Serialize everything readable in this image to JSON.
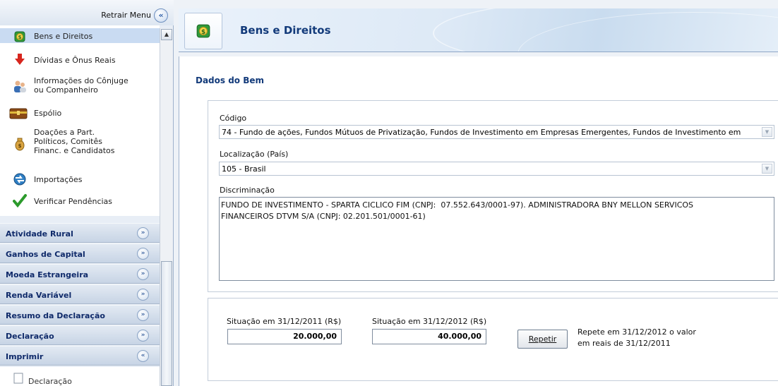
{
  "sidebar": {
    "collapse_label": "Retrair Menu",
    "items": [
      {
        "label": "Bens e Direitos",
        "icon": "money-bag-icon",
        "selected": true
      },
      {
        "label": "Dívidas e Ônus Reais",
        "icon": "red-down-arrow-icon"
      },
      {
        "label": "Informações do Cônjuge\nou Companheiro",
        "icon": "couple-icon"
      },
      {
        "label": "Espólio",
        "icon": "chest-icon"
      },
      {
        "label": "Doações a Part.\nPolíticos, Comitês\nFinanc. e Candidatos",
        "icon": "donation-bag-icon"
      },
      {
        "label": "Importações",
        "icon": "globe-icon"
      },
      {
        "label": "Verificar Pendências",
        "icon": "checkmark-icon"
      }
    ],
    "sections": [
      {
        "label": "Atividade Rural",
        "state": "collapsed"
      },
      {
        "label": "Ganhos de Capital",
        "state": "collapsed"
      },
      {
        "label": "Moeda Estrangeira",
        "state": "collapsed"
      },
      {
        "label": "Renda Variável",
        "state": "collapsed"
      },
      {
        "label": "Resumo da Declaração",
        "state": "collapsed"
      },
      {
        "label": "Declaração",
        "state": "collapsed"
      },
      {
        "label": "Imprimir",
        "state": "expanded"
      }
    ],
    "sub_item": "Declaração"
  },
  "header": {
    "title": "Bens e Direitos"
  },
  "form": {
    "section_title": "Dados do Bem",
    "codigo_label": "Código",
    "codigo_value": "74 - Fundo de ações, Fundos Mútuos de Privatização, Fundos de Investimento em Empresas Emergentes, Fundos de Investimento em",
    "localizacao_label": "Localização (País)",
    "localizacao_value": "105 - Brasil",
    "discriminacao_label": "Discriminação",
    "discriminacao_value": "FUNDO DE INVESTIMENTO - SPARTA CICLICO FIM (CNPJ:  07.552.643/0001-97). ADMINISTRADORA BNY MELLON SERVICOS\nFINANCEIROS DTVM S/A (CNPJ: 02.201.501/0001-61)"
  },
  "valores": {
    "situacao_2011_label": "Situação em 31/12/2011 (R$)",
    "situacao_2011_value": "20.000,00",
    "situacao_2012_label": "Situação em 31/12/2012 (R$)",
    "situacao_2012_value": "40.000,00",
    "repetir_label": "Repetir",
    "repete_text": "Repete em 31/12/2012 o valor\nem reais de 31/12/2011"
  },
  "colors": {
    "accent": "#123a7a",
    "sidebar_bg": "#e8eef6",
    "selected_bg": "#c9dbf2"
  }
}
